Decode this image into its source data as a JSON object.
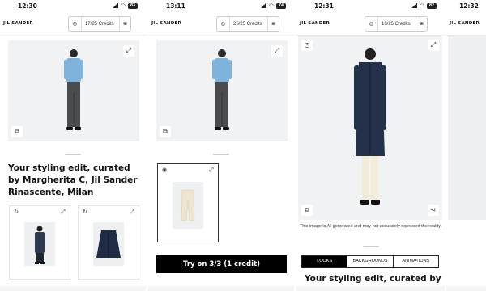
{
  "brand": "JIL SANDER",
  "screens": [
    {
      "time": "12:30",
      "battery": "83",
      "credits": "17/25 Credits"
    },
    {
      "time": "13:11",
      "battery": "74",
      "credits": "25/25 Credits"
    },
    {
      "time": "12:31",
      "battery": "82",
      "credits": "16/25 Credits"
    },
    {
      "time": "12:32",
      "battery": "82",
      "credits": ""
    }
  ],
  "styling_title": "Your styling edit, curated by Margherita C, Jil Sander Rinascente, Milan",
  "styling_title_partial": "Your styling edit, curated by",
  "try_on_button": "Try on 3/3 (1 credit)",
  "disclaimer": "This image is AI-generated and may not accurately represent the reality.",
  "tabs": [
    "LOOKS",
    "BACKGROUNDS",
    "ANIMATIONS"
  ],
  "icons": {
    "expand": "⤢",
    "edit": "⧉",
    "refresh": "↻",
    "share": "⋖",
    "history": "◷",
    "bot": "☺",
    "menu": "≡"
  }
}
